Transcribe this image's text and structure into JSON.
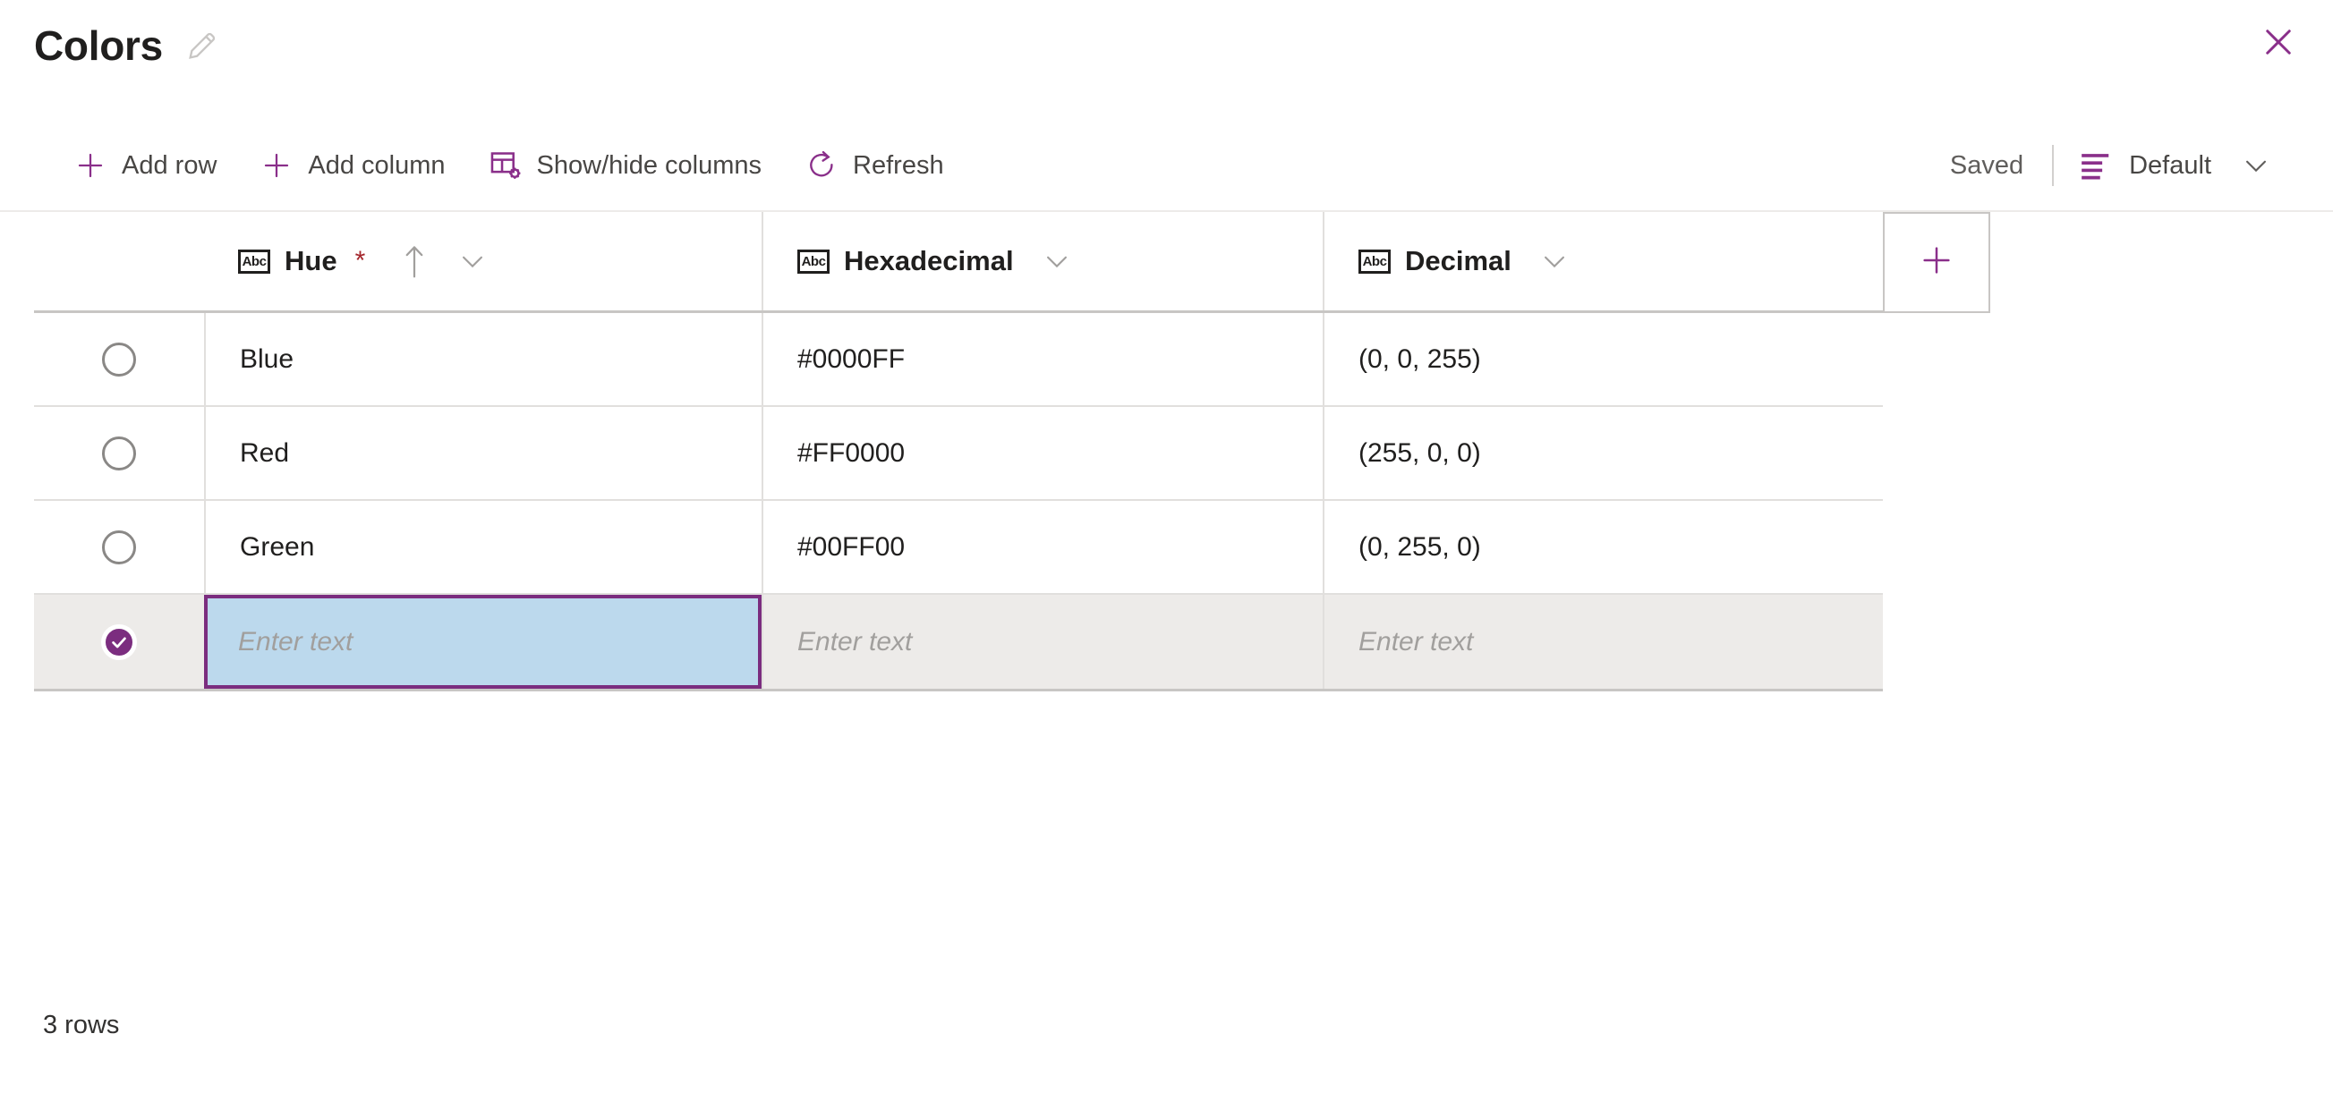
{
  "header": {
    "title": "Colors",
    "edit_icon": "pencil-icon",
    "close_icon": "close-icon"
  },
  "toolbar": {
    "add_row": {
      "label": "Add row",
      "icon": "plus-icon"
    },
    "add_column": {
      "label": "Add column",
      "icon": "plus-icon"
    },
    "show_hide_columns": {
      "label": "Show/hide columns",
      "icon": "table-settings-icon"
    },
    "refresh": {
      "label": "Refresh",
      "icon": "refresh-icon"
    },
    "save_status": "Saved",
    "view": {
      "label": "Default",
      "icon": "view-list-icon",
      "chevron": "chevron-down-icon"
    }
  },
  "grid": {
    "add_column_button_icon": "plus-icon",
    "columns": [
      {
        "label": "Hue",
        "type_icon": "Abc",
        "required": true,
        "required_marker": "*",
        "sorted": true,
        "sort_direction": "ascending",
        "menu_icon": "chevron-down-icon"
      },
      {
        "label": "Hexadecimal",
        "type_icon": "Abc",
        "required": false,
        "sorted": false,
        "menu_icon": "chevron-down-icon"
      },
      {
        "label": "Decimal",
        "type_icon": "Abc",
        "required": false,
        "sorted": false,
        "menu_icon": "chevron-down-icon"
      }
    ],
    "rows": [
      {
        "selected": false,
        "hue": "Blue",
        "hexadecimal": "#0000FF",
        "decimal": "(0, 0, 255)"
      },
      {
        "selected": false,
        "hue": "Red",
        "hexadecimal": "#FF0000",
        "decimal": "(255, 0, 0)"
      },
      {
        "selected": false,
        "hue": "Green",
        "hexadecimal": "#00FF00",
        "decimal": "(0, 255, 0)"
      }
    ],
    "new_row": {
      "selected": true,
      "hue_placeholder": "Enter text",
      "hexadecimal_placeholder": "Enter text",
      "decimal_placeholder": "Enter text"
    }
  },
  "footer": {
    "row_count": "3 rows"
  },
  "colors": {
    "accent": "#7B2D7F",
    "required_asterisk": "#A4262C",
    "selected_row_bg": "#EDEBE9",
    "active_cell_bg": "#BCD9ED",
    "text": "#201F1E",
    "muted_text": "#605E5C"
  }
}
